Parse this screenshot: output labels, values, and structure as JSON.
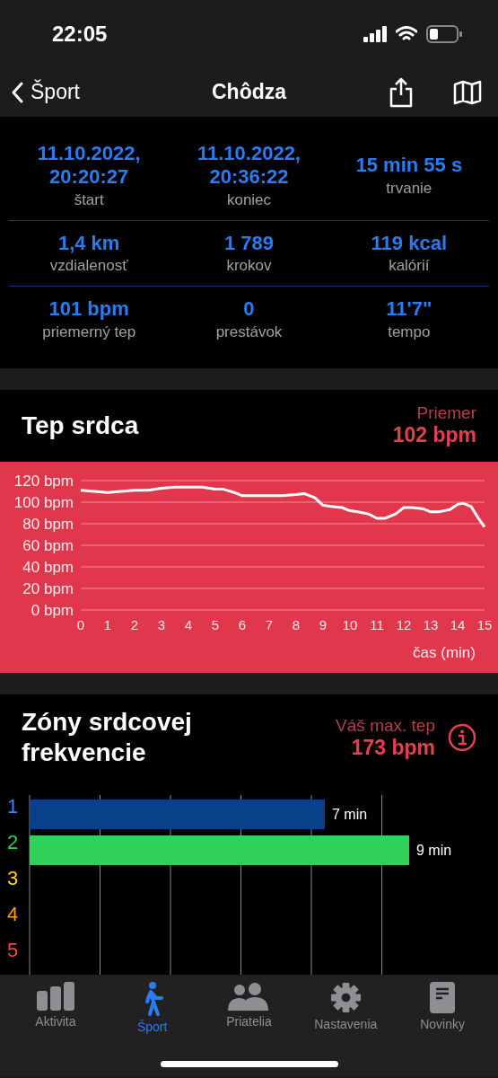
{
  "status_bar": {
    "time": "22:05"
  },
  "nav_bar": {
    "back": "Šport",
    "title": "Chôdza"
  },
  "stats": [
    {
      "value": "11.10.2022, 20:20:27",
      "label": "štart"
    },
    {
      "value": "11.10.2022, 20:36:22",
      "label": "koniec"
    },
    {
      "value": "15 min 55 s",
      "label": "trvanie"
    },
    {
      "value": "1,4 km",
      "label": "vzdialenosť"
    },
    {
      "value": "1 789",
      "label": "krokov"
    },
    {
      "value": "119 kcal",
      "label": "kalórií"
    },
    {
      "value": "101 bpm",
      "label": "priemerný tep"
    },
    {
      "value": "0",
      "label": "prestávok"
    },
    {
      "value": "11'7\"",
      "label": "tempo"
    }
  ],
  "heart_rate": {
    "title": "Tep srdca",
    "average_label": "Priemer",
    "average_value": "102 bpm",
    "chart_data": {
      "type": "line",
      "xlabel": "čas (min)",
      "x": [
        0,
        0.5,
        1,
        1.5,
        2,
        2.5,
        3,
        3.5,
        4,
        4.5,
        5,
        5.3,
        5.7,
        6,
        6.5,
        7,
        7.5,
        8,
        8.3,
        8.7,
        9,
        9.3,
        9.7,
        10,
        10.3,
        10.7,
        11,
        11.3,
        11.7,
        12,
        12.3,
        12.7,
        13,
        13.3,
        13.7,
        14,
        14.2,
        14.5,
        14.8,
        15
      ],
      "grid": true,
      "series": [
        {
          "color": "#ffffff",
          "values": [
            111,
            110,
            109,
            110,
            111,
            111,
            113,
            114,
            114,
            114,
            112,
            112,
            109,
            106,
            106,
            106,
            106,
            107,
            108,
            104,
            97,
            96,
            95,
            92,
            91,
            89,
            85,
            85,
            89,
            95,
            95,
            94,
            91,
            91,
            93,
            98,
            99,
            96,
            84,
            77
          ]
        }
      ],
      "xlim": [
        0,
        15
      ],
      "ylim": [
        0,
        120
      ],
      "xticks": [
        0,
        1,
        2,
        3,
        4,
        5,
        6,
        7,
        8,
        9,
        10,
        11,
        12,
        13,
        14,
        15
      ],
      "yticks": [
        {
          "value": 0,
          "label": "0 bpm"
        },
        {
          "value": 20,
          "label": "20 bpm"
        },
        {
          "value": 40,
          "label": "40 bpm"
        },
        {
          "value": 60,
          "label": "60 bpm"
        },
        {
          "value": 80,
          "label": "80 bpm"
        },
        {
          "value": 100,
          "label": "100 bpm"
        },
        {
          "value": 120,
          "label": "120 bpm"
        }
      ]
    }
  },
  "zones": {
    "title": "Zóny srdcovej frekvencie",
    "max_label": "Váš max. tep",
    "max_value": "173 bpm",
    "chart_data": {
      "type": "bar",
      "orientation": "horizontal",
      "stacked": true,
      "categories": [
        "1",
        "2",
        "3",
        "4",
        "5"
      ],
      "series": [
        {
          "color": "#06418a",
          "values": [
            7,
            null,
            null,
            null,
            null
          ],
          "value_labels": [
            "7 min",
            null,
            null,
            null,
            null
          ]
        },
        {
          "color": "#30d158",
          "values": [
            null,
            9,
            null,
            null,
            null
          ],
          "value_labels": [
            null,
            "9 min",
            null,
            null,
            null
          ]
        }
      ]
    },
    "levels": [
      {
        "color": "#3a82f7"
      },
      {
        "color": "#30d158"
      },
      {
        "color": "#ffd60a"
      },
      {
        "color": "#ff9f0a"
      },
      {
        "color": "#ff453a"
      }
    ]
  },
  "tab_bar": [
    {
      "label": "Aktivita",
      "selected": false
    },
    {
      "label": "Šport",
      "selected": true
    },
    {
      "label": "Priatelia",
      "selected": false
    },
    {
      "label": "Nastavenia",
      "selected": false
    },
    {
      "label": "Novinky",
      "selected": false
    }
  ]
}
